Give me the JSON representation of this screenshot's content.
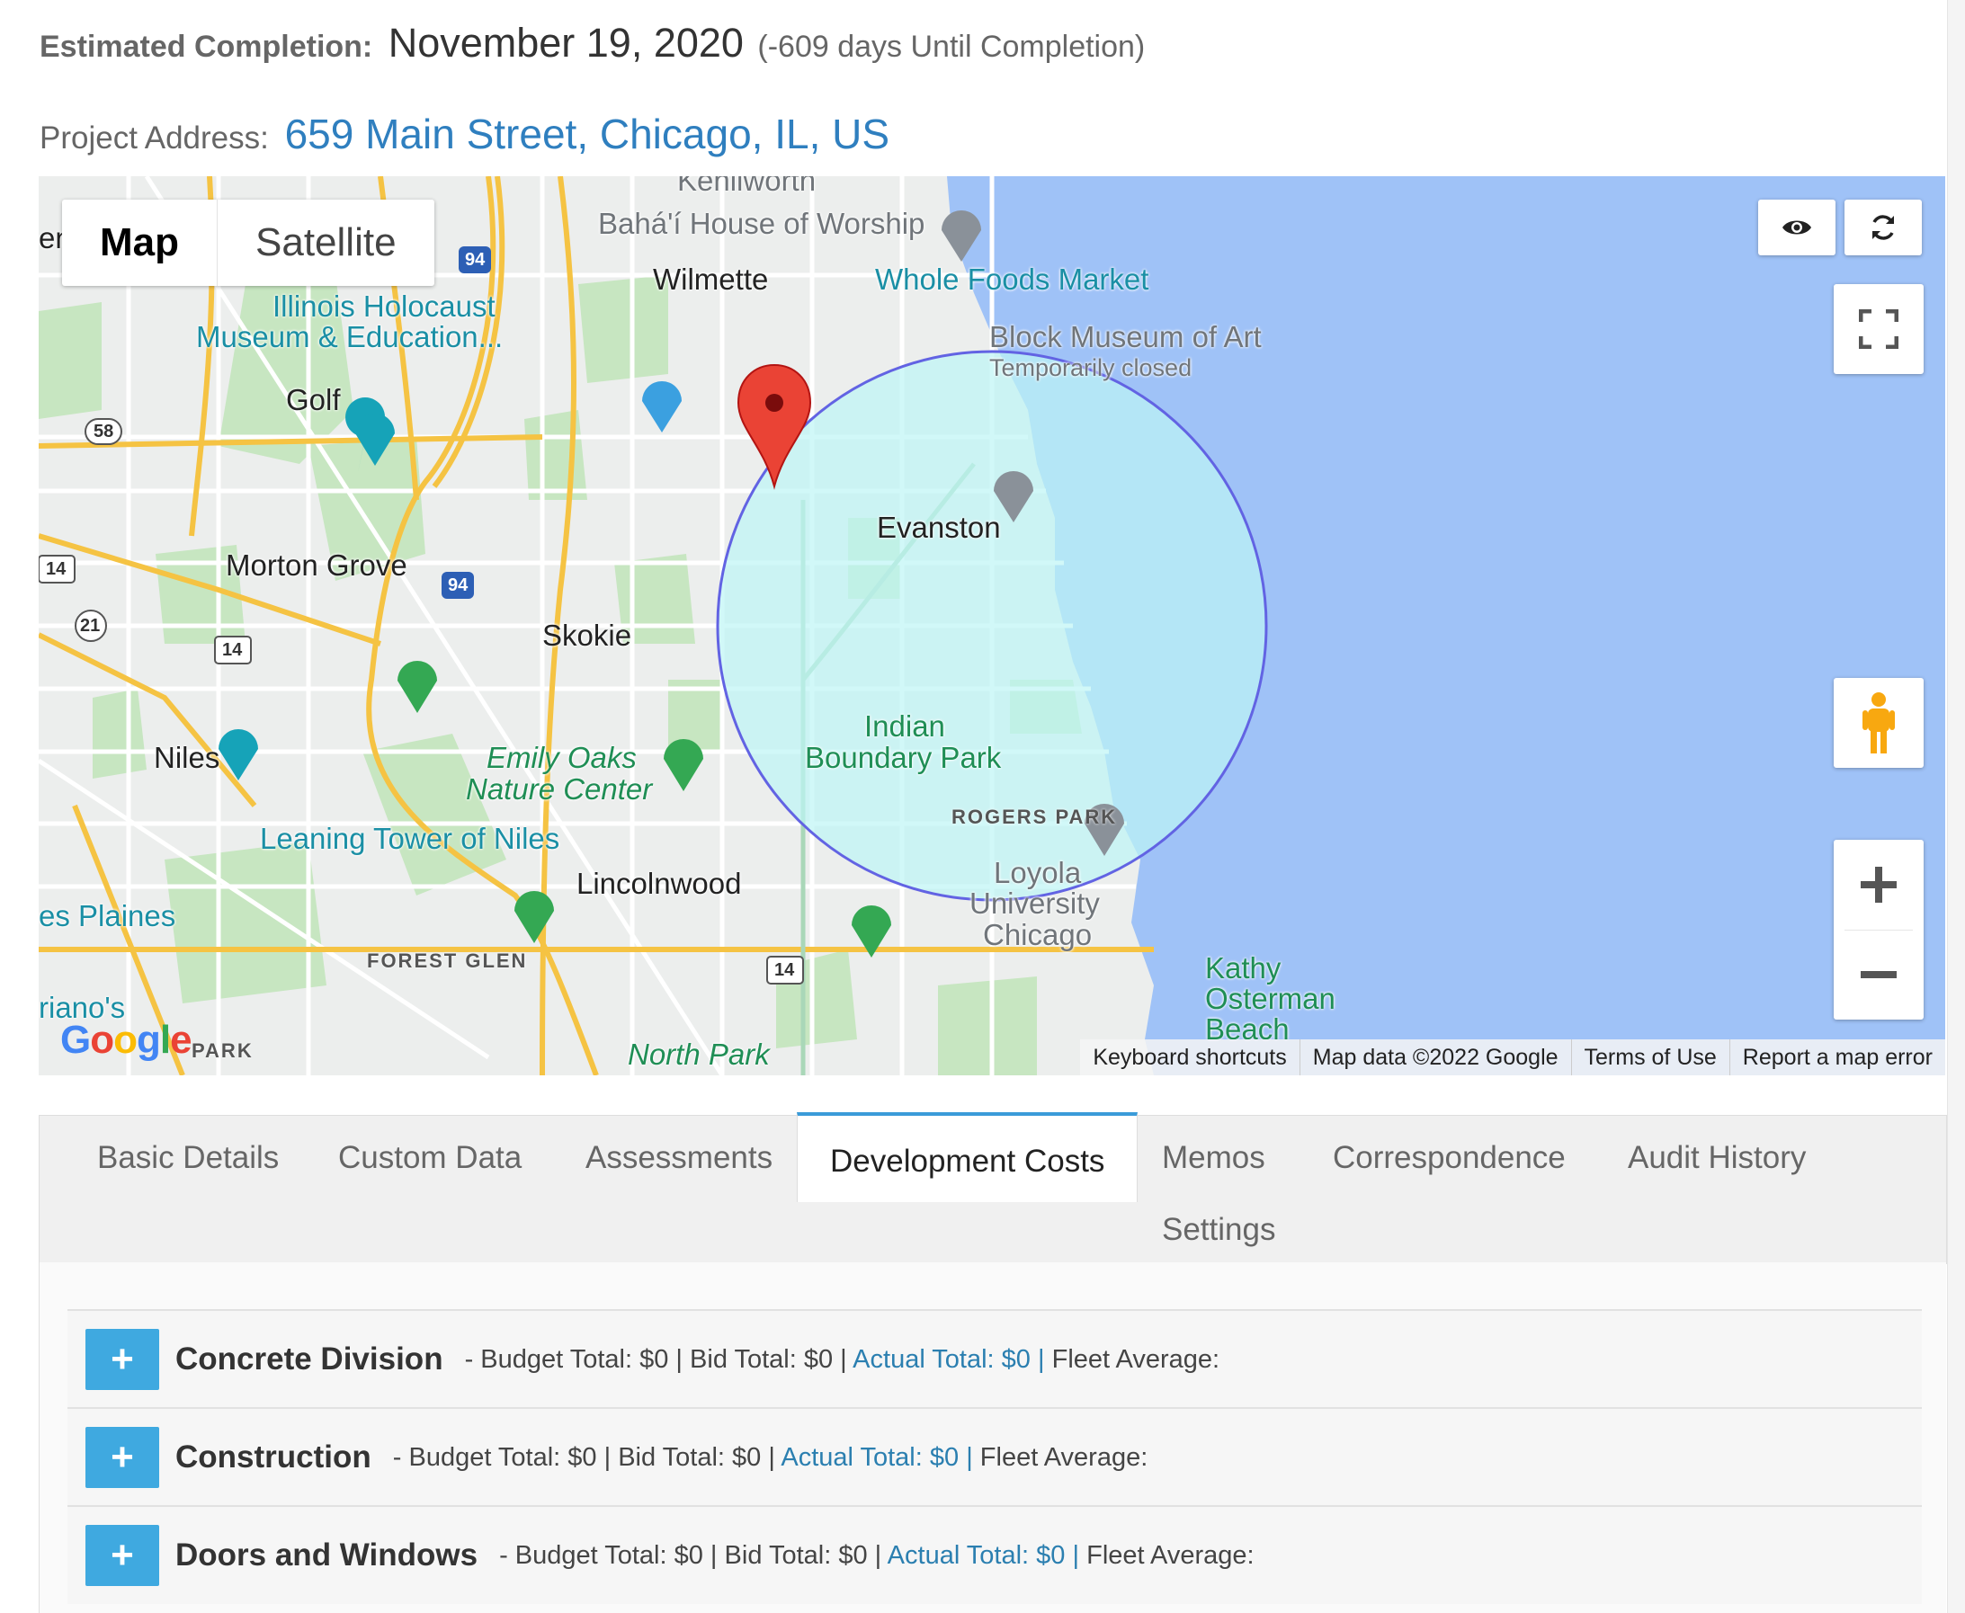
{
  "estimate": {
    "label": "Estimated Completion:",
    "date": "November 19, 2020",
    "days": "(-609 days Until Completion)"
  },
  "address": {
    "label": "Project Address:",
    "value": "659 Main Street, Chicago, IL, US"
  },
  "map": {
    "type_map": "Map",
    "type_satellite": "Satellite",
    "labels": {
      "kenilworth": "Kenilworth",
      "bahai": "Bahá'í House of Worship",
      "wilmette": "Wilmette",
      "whole_foods": "Whole Foods Market",
      "holocaust1": "Illinois Holocaust",
      "holocaust2": "Museum & Education...",
      "block1": "Block Museum of Art",
      "block2": "Temporarily closed",
      "golf": "Golf",
      "evanston": "Evanston",
      "morton_grove": "Morton Grove",
      "skokie": "Skokie",
      "niles": "Niles",
      "emily1": "Emily Oaks",
      "emily2": "Nature Center",
      "indian1": "Indian",
      "indian2": "Boundary Park",
      "rogers": "ROGERS PARK",
      "leaning": "Leaning Tower of Niles",
      "loyola1": "Loyola",
      "loyola2": "University",
      "loyola3": "Chicago",
      "lincolnwood": "Lincolnwood",
      "des_plaines": "es Plaines",
      "forest_glen": "FOREST GLEN",
      "kathy1": "Kathy",
      "kathy2": "Osterman",
      "kathy3": "Beach",
      "rianos": "riano's",
      "north_park": "North Park",
      "park": "PARK",
      "en": "en",
      "route_94a": "94",
      "route_94b": "94",
      "route_58": "58",
      "route_14a": "14",
      "route_14b": "14",
      "route_14c": "14",
      "route_21": "21"
    },
    "attribution": [
      "Keyboard shortcuts",
      "Map data ©2022 Google",
      "Terms of Use",
      "Report a map error"
    ],
    "google": "Google"
  },
  "tabs": [
    "Basic Details",
    "Custom Data",
    "Assessments",
    "Development Costs",
    "Memos",
    "Correspondence",
    "Audit History",
    "Settings"
  ],
  "active_tab": "Development Costs",
  "divisions": [
    {
      "name": "Concrete Division",
      "budget": "- Budget Total: $0",
      "bid": "Bid Total: $0",
      "actual": "Actual Total: $0",
      "fleet": "Fleet Average:"
    },
    {
      "name": "Construction",
      "budget": "- Budget Total: $0",
      "bid": "Bid Total: $0",
      "actual": "Actual Total: $0",
      "fleet": "Fleet Average:"
    },
    {
      "name": "Doors and Windows",
      "budget": "- Budget Total: $0",
      "bid": "Bid Total: $0",
      "actual": "Actual Total: $0",
      "fleet": "Fleet Average:"
    }
  ],
  "colors": {
    "accent": "#3fa9e0",
    "link": "#2f7fbf",
    "water": "#9fc2f7",
    "pin": "#ea4335"
  }
}
